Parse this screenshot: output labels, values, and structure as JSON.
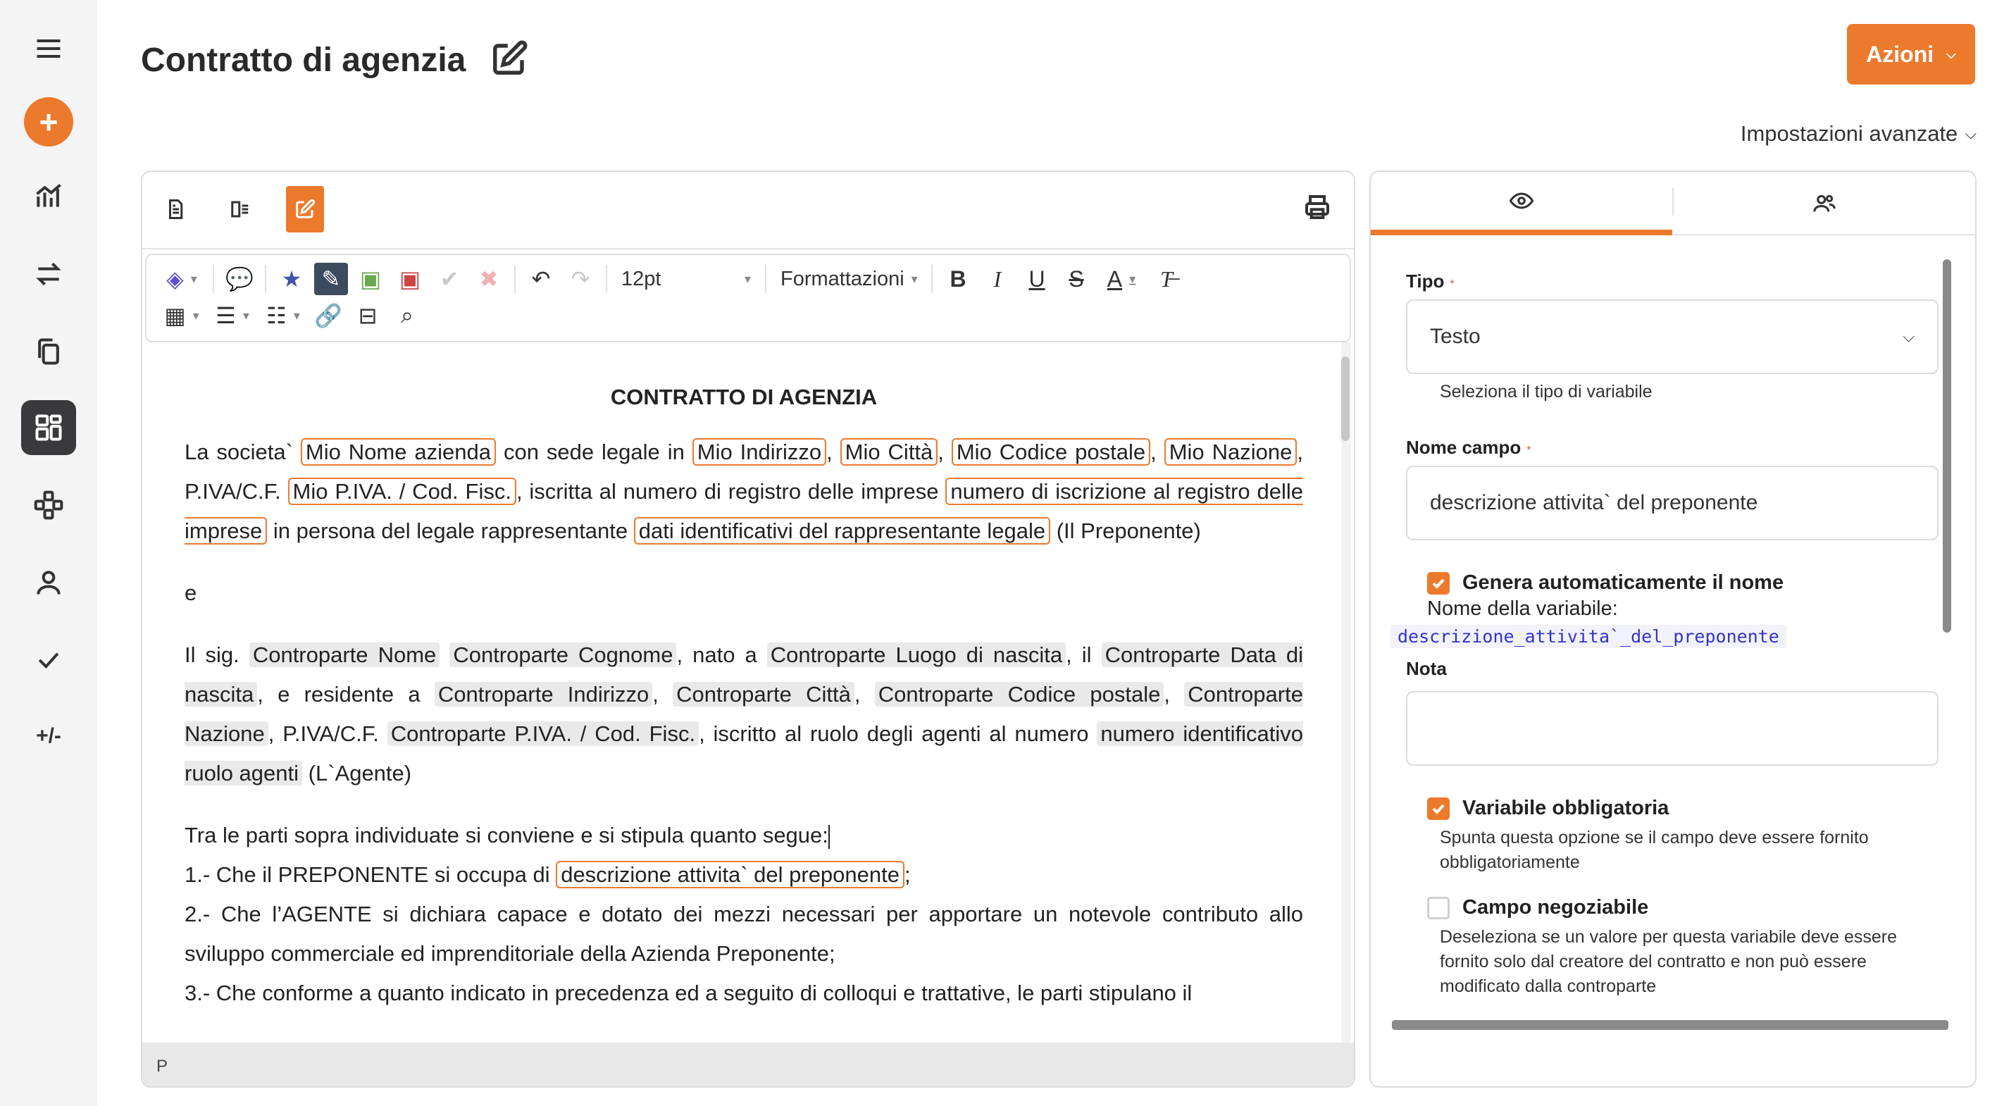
{
  "rail": {
    "items": [
      {
        "name": "menu-icon"
      },
      {
        "name": "add-icon"
      },
      {
        "name": "analytics-icon"
      },
      {
        "name": "transfer-icon"
      },
      {
        "name": "documents-icon"
      },
      {
        "name": "dashboard-icon"
      },
      {
        "name": "workflow-icon"
      },
      {
        "name": "user-icon"
      },
      {
        "name": "check-icon"
      },
      {
        "name": "diff-icon",
        "label": "+/-"
      }
    ],
    "add_label": "+",
    "diff_label": "+/-"
  },
  "header": {
    "title": "Contratto di agenzia",
    "actions_label": "Azioni",
    "advanced_settings": "Impostazioni avanzate"
  },
  "toolbar": {
    "font_size": "12pt",
    "formats_label": "Formattazioni"
  },
  "document": {
    "heading": "CONTRATTO DI AGENZIA",
    "p1": {
      "t1": "La societa`",
      "v1": "Mio Nome azienda",
      "t2": "con sede legale in",
      "v2": "Mio Indirizzo",
      "t3": ",",
      "v3": "Mio Città",
      "t4": ",",
      "v4": "Mio Codice postale",
      "t5": ",",
      "v5": "Mio Nazione",
      "t6": ", P.IVA/C.F.",
      "v6": "Mio P.IVA. / Cod. Fisc.",
      "t7": ", iscritta al numero di registro delle imprese",
      "v7": "numero di iscrizione al registro delle imprese",
      "t8": "in persona del legale rappresentante",
      "v8": "dati identificativi del rappresentante legale",
      "t9": "(Il Preponente)"
    },
    "p2": "e",
    "p3": {
      "t1": "Il sig.",
      "v1": "Controparte Nome",
      "v2": "Controparte Cognome",
      "t2": ", nato a",
      "v3": "Controparte Luogo di nascita",
      "t3": ", il",
      "v4": "Controparte Data di nascita",
      "t4": ", e residente a",
      "v5": "Controparte Indirizzo",
      "t5": ",",
      "v6": "Controparte Città",
      "t6": ",",
      "v7": "Controparte Codice postale",
      "t7": ",",
      "v8": "Controparte Nazione",
      "t8": ", P.IVA/C.F.",
      "v9": "Controparte P.IVA. / Cod. Fisc.",
      "t9": ", iscritto al ruolo degli agenti al numero",
      "v10": "numero identificativo ruolo agenti",
      "t10": "(L`Agente)"
    },
    "p4": "Tra le parti sopra individuate si conviene e si stipula quanto segue:",
    "p5": {
      "t1": "1.- Che il PREPONENTE si occupa di",
      "v1": "descrizione attivita` del preponente",
      "t2": ";"
    },
    "p6": "2.- Che l’AGENTE si dichiara capace e dotato dei mezzi necessari per apportare un notevole contributo allo sviluppo commerciale ed imprenditoriale della Azienda Preponente;",
    "p7": "3.- Che conforme a quanto indicato in precedenza ed a seguito di colloqui e trattative, le parti stipulano il",
    "status_tag": "P"
  },
  "side": {
    "type_label": "Tipo",
    "type_value": "Testo",
    "type_help": "Seleziona il tipo di variabile",
    "name_label": "Nome campo",
    "name_value": "descrizione attivita` del preponente",
    "autoname_label": "Genera automaticamente il nome",
    "varname_label": "Nome della variabile:",
    "varname_value": "descrizione_attivita`_del_preponente",
    "note_label": "Nota",
    "note_value": "",
    "required_label": "Variabile obbligatoria",
    "required_help": "Spunta questa opzione se il campo deve essere fornito obbligatoriamente",
    "negotiable_label": "Campo negoziabile",
    "negotiable_help": "Deseleziona se un valore per questa variabile deve essere fornito solo dal creatore del contratto e non può essere modificato dalla controparte",
    "req_mark": "*"
  },
  "colors": {
    "accent": "#ec7a2c",
    "rail_bg": "#f4f4f5",
    "active_rail": "#3a3a3c"
  }
}
